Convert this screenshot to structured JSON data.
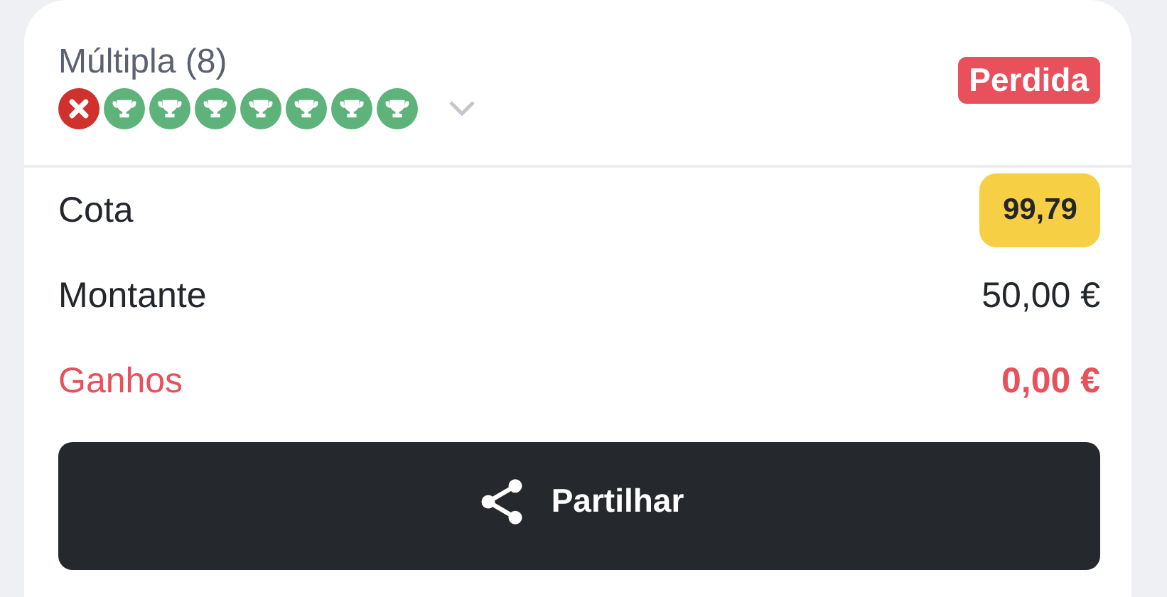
{
  "bet": {
    "title": "Múltipla (8)",
    "status": "Perdida",
    "expanded": false,
    "legs": [
      {
        "won": false
      },
      {
        "won": true
      },
      {
        "won": true
      },
      {
        "won": true
      },
      {
        "won": true
      },
      {
        "won": true
      },
      {
        "won": true
      },
      {
        "won": true
      }
    ],
    "rows": [
      {
        "kind": "odds",
        "label": "Cota",
        "value": "99,79"
      },
      {
        "kind": "plain",
        "label": "Montante",
        "value": "50,00 €"
      },
      {
        "kind": "winnings",
        "label": "Ganhos",
        "value": "0,00 €"
      }
    ],
    "share_button": "Partilhar"
  }
}
